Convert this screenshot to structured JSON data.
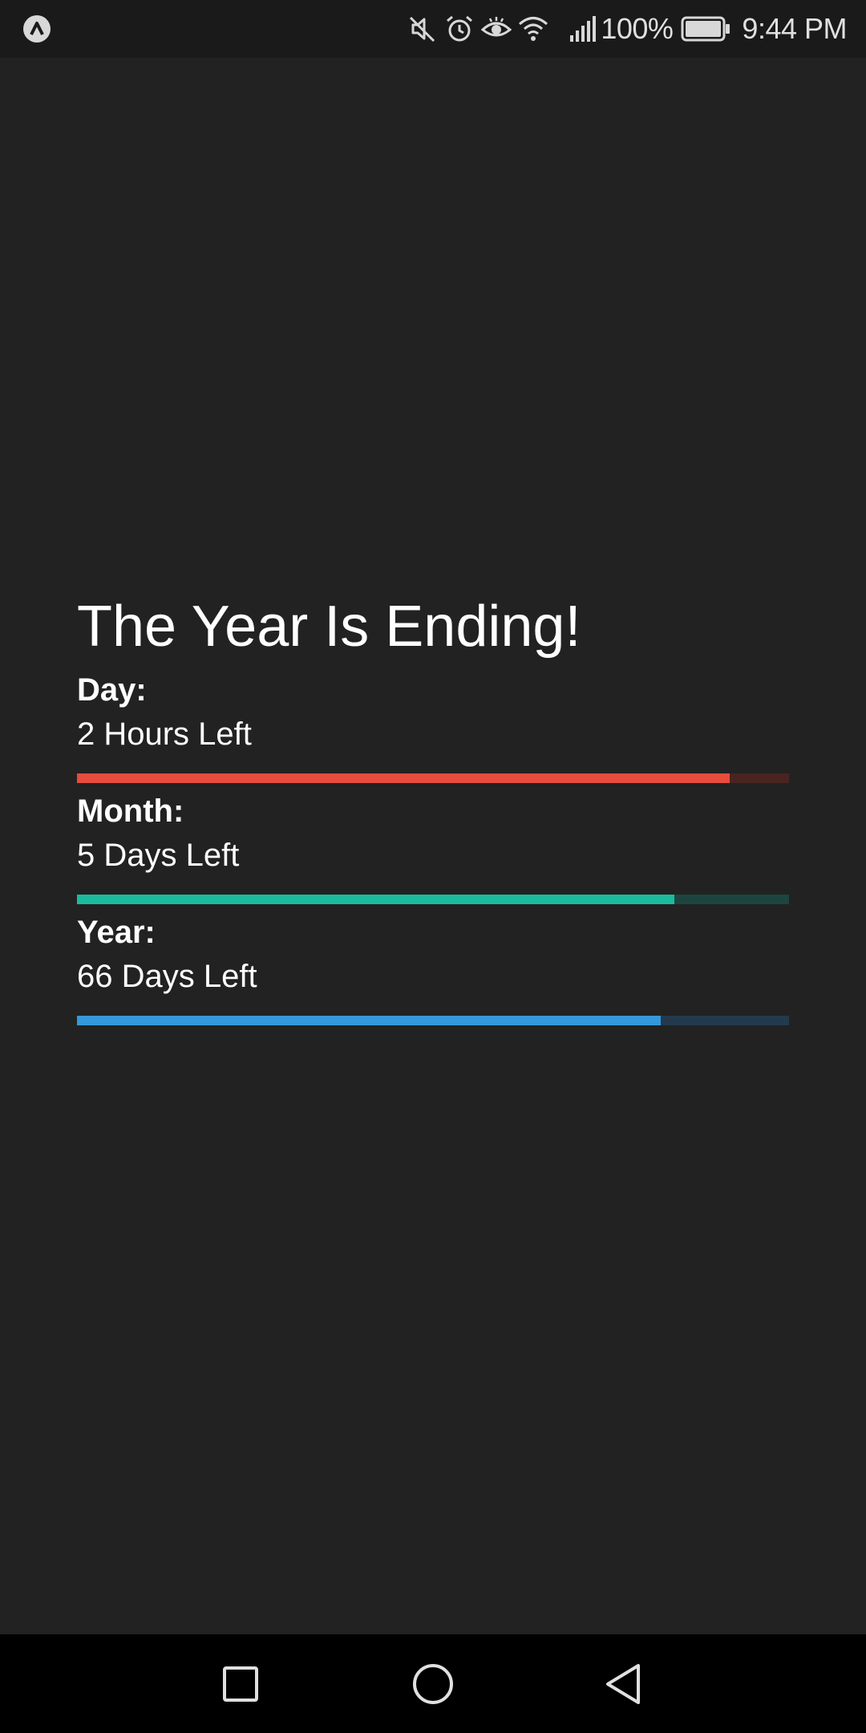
{
  "status_bar": {
    "battery_text": "100%",
    "time": "9:44 PM",
    "icons": [
      "app-notification-icon",
      "mute-icon",
      "alarm-icon",
      "eye-comfort-icon",
      "wifi-icon",
      "signal-icon",
      "battery-icon"
    ]
  },
  "main": {
    "title": "The Year Is Ending!",
    "progress": [
      {
        "label": "Day:",
        "value": "2 Hours Left",
        "fraction": 0.917,
        "color": "#e74c3c",
        "track_color": "#4a2420"
      },
      {
        "label": "Month:",
        "value": "5 Days Left",
        "fraction": 0.839,
        "color": "#1abc9c",
        "track_color": "#1d4540"
      },
      {
        "label": "Year:",
        "value": "66 Days Left",
        "fraction": 0.82,
        "color": "#3498db",
        "track_color": "#233a4d"
      }
    ]
  },
  "nav_bar": {
    "buttons": [
      "recents-button",
      "home-button",
      "back-button"
    ]
  }
}
